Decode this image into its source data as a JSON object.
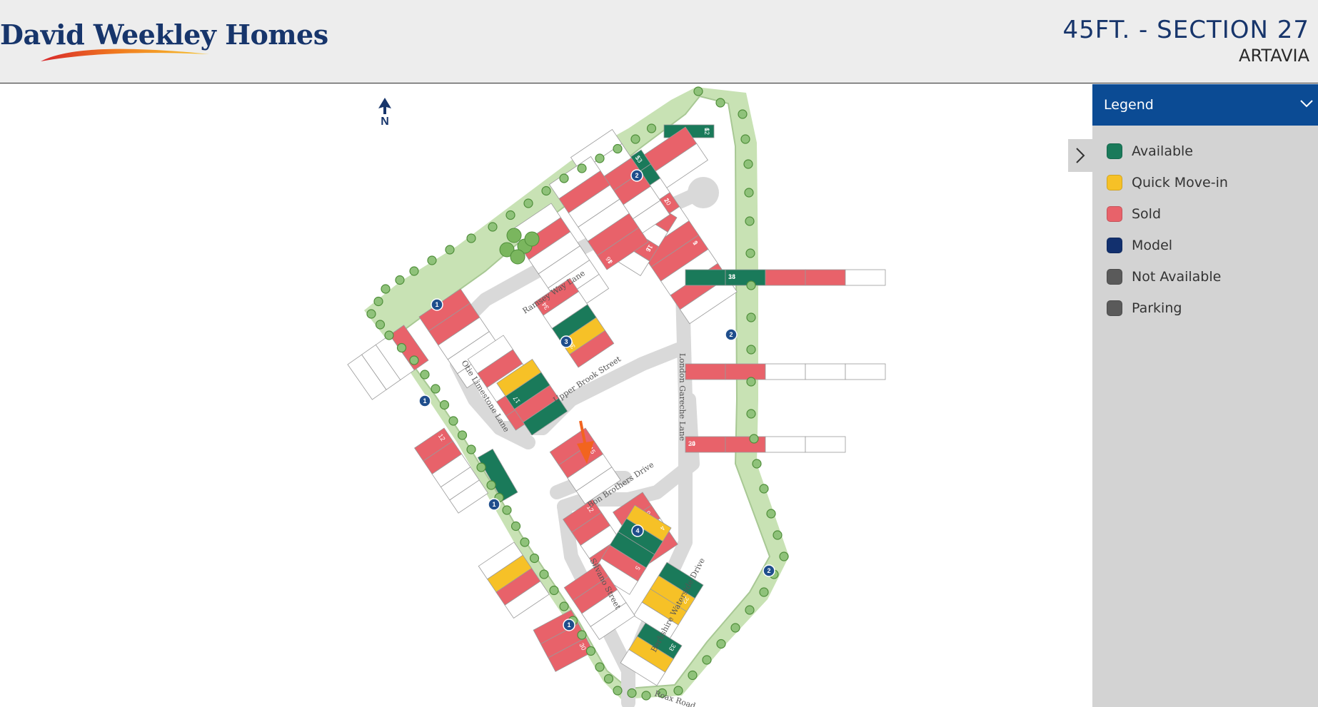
{
  "header": {
    "brand": "David Weekley Homes",
    "title": "45FT. - SECTION 27",
    "subtitle": "ARTAVIA"
  },
  "legend": {
    "title": "Legend",
    "items": [
      {
        "label": "Available",
        "color": "#1a7a5a"
      },
      {
        "label": "Quick Move-in",
        "color": "#f6c127"
      },
      {
        "label": "Sold",
        "color": "#e8626a"
      },
      {
        "label": "Model",
        "color": "#12306e"
      },
      {
        "label": "Not Available",
        "color": "#5a5a5a"
      },
      {
        "label": "Parking",
        "color": "#5a5a5a"
      }
    ]
  },
  "map": {
    "north_label": "N",
    "streets": [
      "Ramsey Way Lane",
      "Upper Brook Street",
      "Otie Limestone Lane",
      "London Gareche Lane",
      "Bon Brothers Drive",
      "Silvano Street",
      "Berkshire Waterside Drive",
      "Roax Road"
    ],
    "markers": [
      "1",
      "2",
      "3",
      "4"
    ],
    "lot_numbers": [
      "12",
      "13",
      "10",
      "9",
      "6",
      "5",
      "2",
      "16",
      "18",
      "19",
      "20",
      "24",
      "25",
      "28",
      "29",
      "45",
      "46",
      "41",
      "27",
      "26",
      "35",
      "34",
      "17",
      "15",
      "12",
      "8",
      "9",
      "4",
      "5",
      "22",
      "33",
      "24",
      "26",
      "30",
      "31",
      "13",
      "12",
      "18",
      "6",
      "5",
      "2",
      "1",
      "14",
      "9",
      "8",
      "11",
      "34",
      "35",
      "36",
      "39",
      "42",
      "43",
      "3",
      "2",
      "1"
    ],
    "colors": {
      "available": "#1a7a5a",
      "quick": "#f6c127",
      "sold": "#e8626a",
      "road": "#d6d6d6",
      "green": "#c5dfb1",
      "tree": "#6aa84f",
      "marker": "#1f4e8c"
    }
  }
}
